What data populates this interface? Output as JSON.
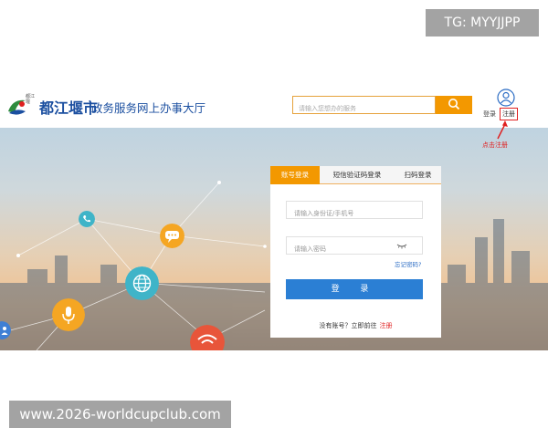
{
  "watermarks": {
    "top": "TG: MYYJJPP",
    "bottom": "www.2026-worldcupclub.com"
  },
  "header": {
    "logo_small_text": "都江堰",
    "city_name": "都江堰市",
    "portal_title": "政务服务网上办事大厅",
    "search_placeholder": "请输入您想办的服务",
    "login_link": "登录",
    "register_link": "注册",
    "annotation": "点击注册"
  },
  "login_panel": {
    "tabs": [
      {
        "label": "账号登录",
        "active": true
      },
      {
        "label": "短信验证码登录",
        "active": false
      },
      {
        "label": "扫码登录",
        "active": false
      }
    ],
    "id_placeholder": "请输入身份证/手机号",
    "password_placeholder": "请输入密码",
    "forgot_password": "忘记密码?",
    "login_button": "登 录",
    "no_account_text": "没有账号？立即前往",
    "register_link": "注册"
  },
  "icons": {
    "search": "search-icon",
    "user": "user-icon",
    "eye": "eye-closed-icon",
    "nodes": [
      "phone-icon",
      "chat-icon",
      "globe-icon",
      "microphone-icon",
      "wifi-icon",
      "people-icon"
    ]
  },
  "colors": {
    "accent": "#f39800",
    "primary": "#2b7fd4",
    "brand": "#1b4fa0",
    "alert": "#e02020"
  }
}
